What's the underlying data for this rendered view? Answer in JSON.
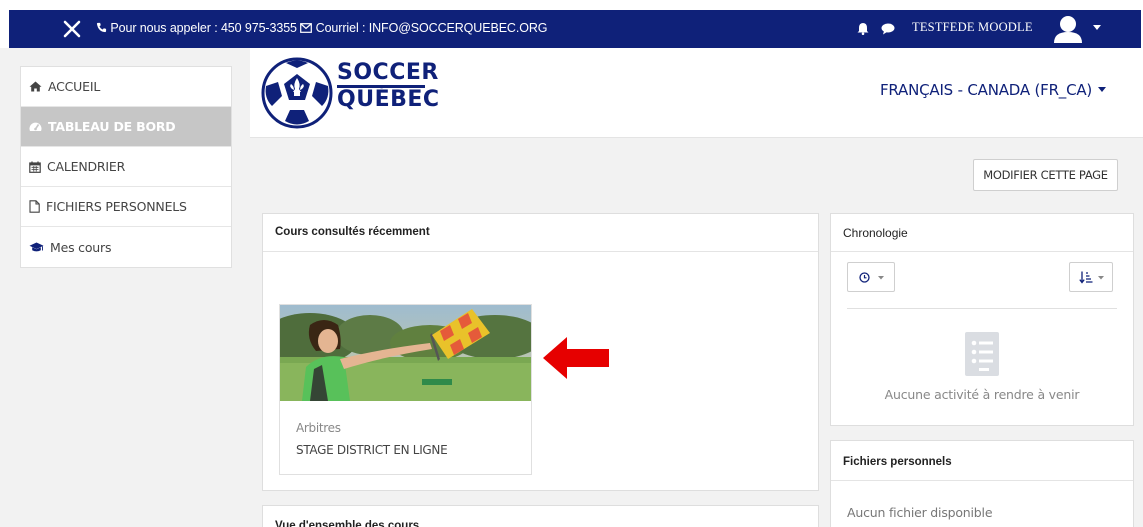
{
  "topbar": {
    "contact_text": "Pour nous appeler : 450 975-3355",
    "email_text": "Courriel : INFO@SOCCERQUEBEC.ORG",
    "username": "TESTFEDE MOODLE"
  },
  "sidebar": {
    "items": [
      {
        "label": "ACCUEIL",
        "icon": "home-icon"
      },
      {
        "label": "TABLEAU DE BORD",
        "icon": "dashboard-icon",
        "active": true
      },
      {
        "label": "CALENDRIER",
        "icon": "calendar-icon"
      },
      {
        "label": "FICHIERS PERSONNELS",
        "icon": "file-icon"
      },
      {
        "label": "Mes cours",
        "icon": "graduation-cap-icon"
      }
    ]
  },
  "header": {
    "logo_line1": "SOCCER",
    "logo_line2": "QUÉBEC",
    "language": "FRANÇAIS - CANADA (FR_CA)"
  },
  "main": {
    "edit_button": "MODIFIER CETTE PAGE",
    "recent_title": "Cours consultés récemment",
    "course": {
      "category": "Arbitres",
      "name": "STAGE DISTRICT EN LIGNE"
    },
    "overview_title": "Vue d'ensemble des cours"
  },
  "chronologie": {
    "title": "Chronologie",
    "empty": "Aucune activité à rendre à venir"
  },
  "files": {
    "title": "Fichiers personnels",
    "empty": "Aucun fichier disponible"
  },
  "colors": {
    "brand": "#0f2179",
    "arrow": "#e60000",
    "active_nav": "#c6c6c6"
  }
}
